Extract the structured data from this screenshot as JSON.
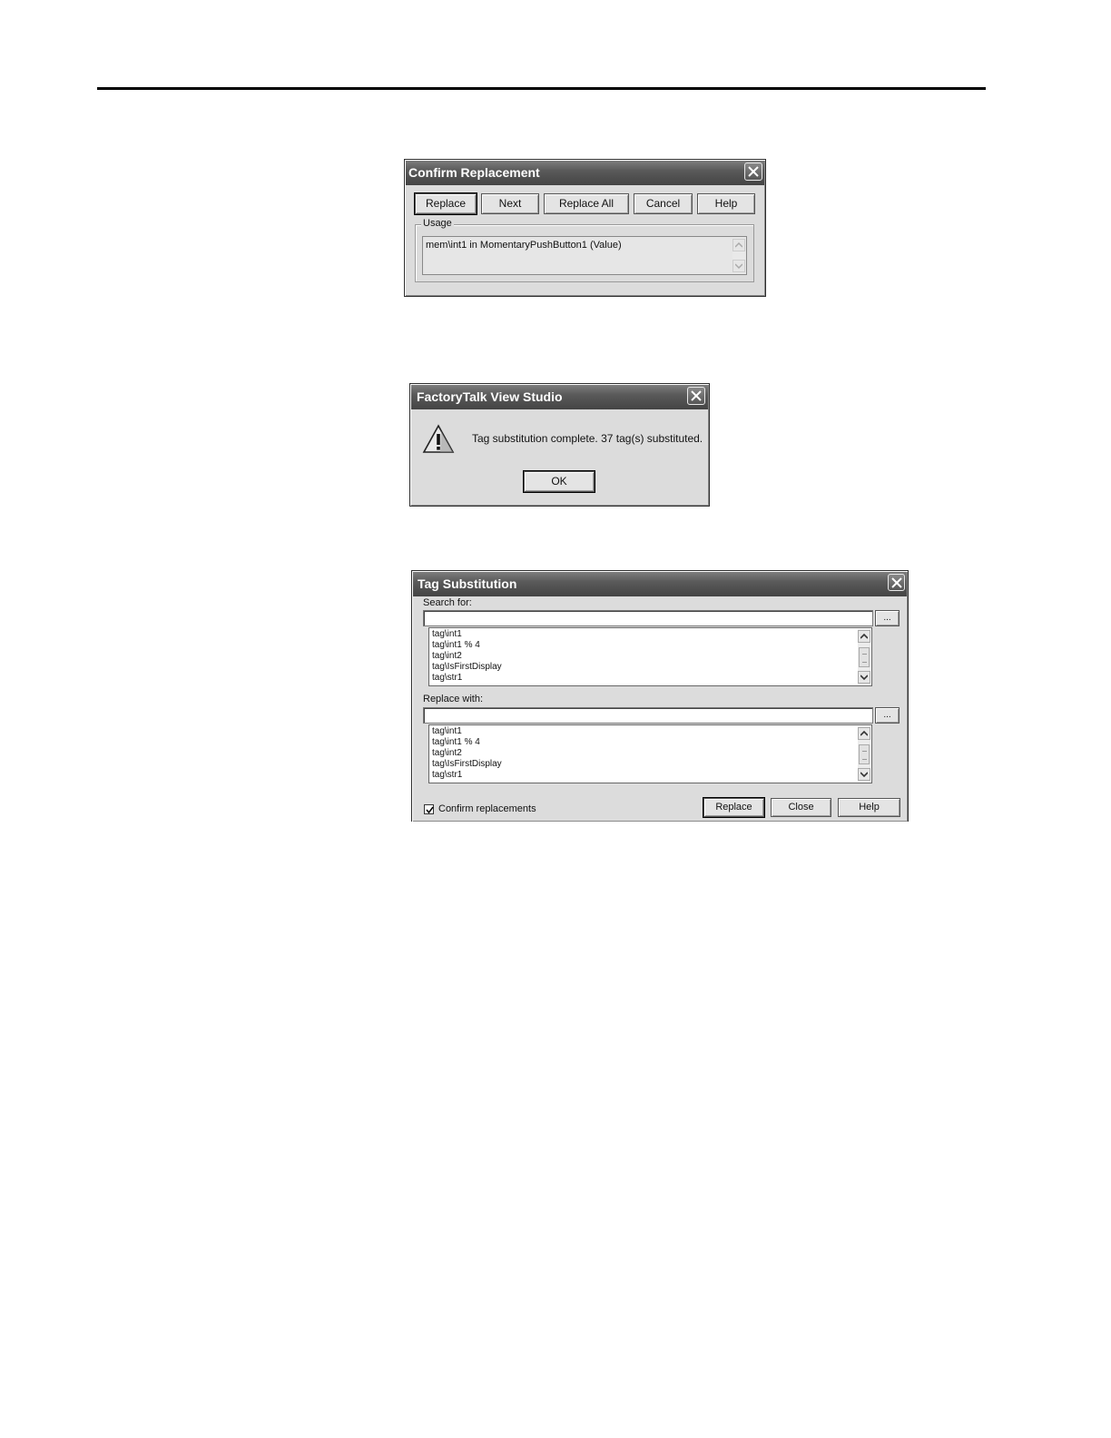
{
  "confirm_dialog": {
    "title": "Confirm Replacement",
    "buttons": {
      "replace": "Replace",
      "next": "Next",
      "replace_all": "Replace All",
      "cancel": "Cancel",
      "help": "Help"
    },
    "usage_label": "Usage",
    "usage_text": "mem\\int1 in MomentaryPushButton1 (Value)"
  },
  "message_dialog": {
    "title": "FactoryTalk View Studio",
    "icon": "warning-icon",
    "message": "Tag substitution complete. 37 tag(s) substituted.",
    "ok_label": "OK"
  },
  "tag_dialog": {
    "title": "Tag Substitution",
    "search_label": "Search for:",
    "search_value": "",
    "search_browse": "...",
    "search_list": [
      "tag\\int1",
      "tag\\int1 % 4",
      "tag\\int2",
      "tag\\IsFirstDisplay",
      "tag\\str1"
    ],
    "replace_label": "Replace with:",
    "replace_value": "",
    "replace_browse": "...",
    "replace_list": [
      "tag\\int1",
      "tag\\int1 % 4",
      "tag\\int2",
      "tag\\IsFirstDisplay",
      "tag\\str1"
    ],
    "confirm_checkbox_label": "Confirm replacements",
    "confirm_checked": true,
    "buttons": {
      "replace": "Replace",
      "close": "Close",
      "help": "Help"
    }
  }
}
